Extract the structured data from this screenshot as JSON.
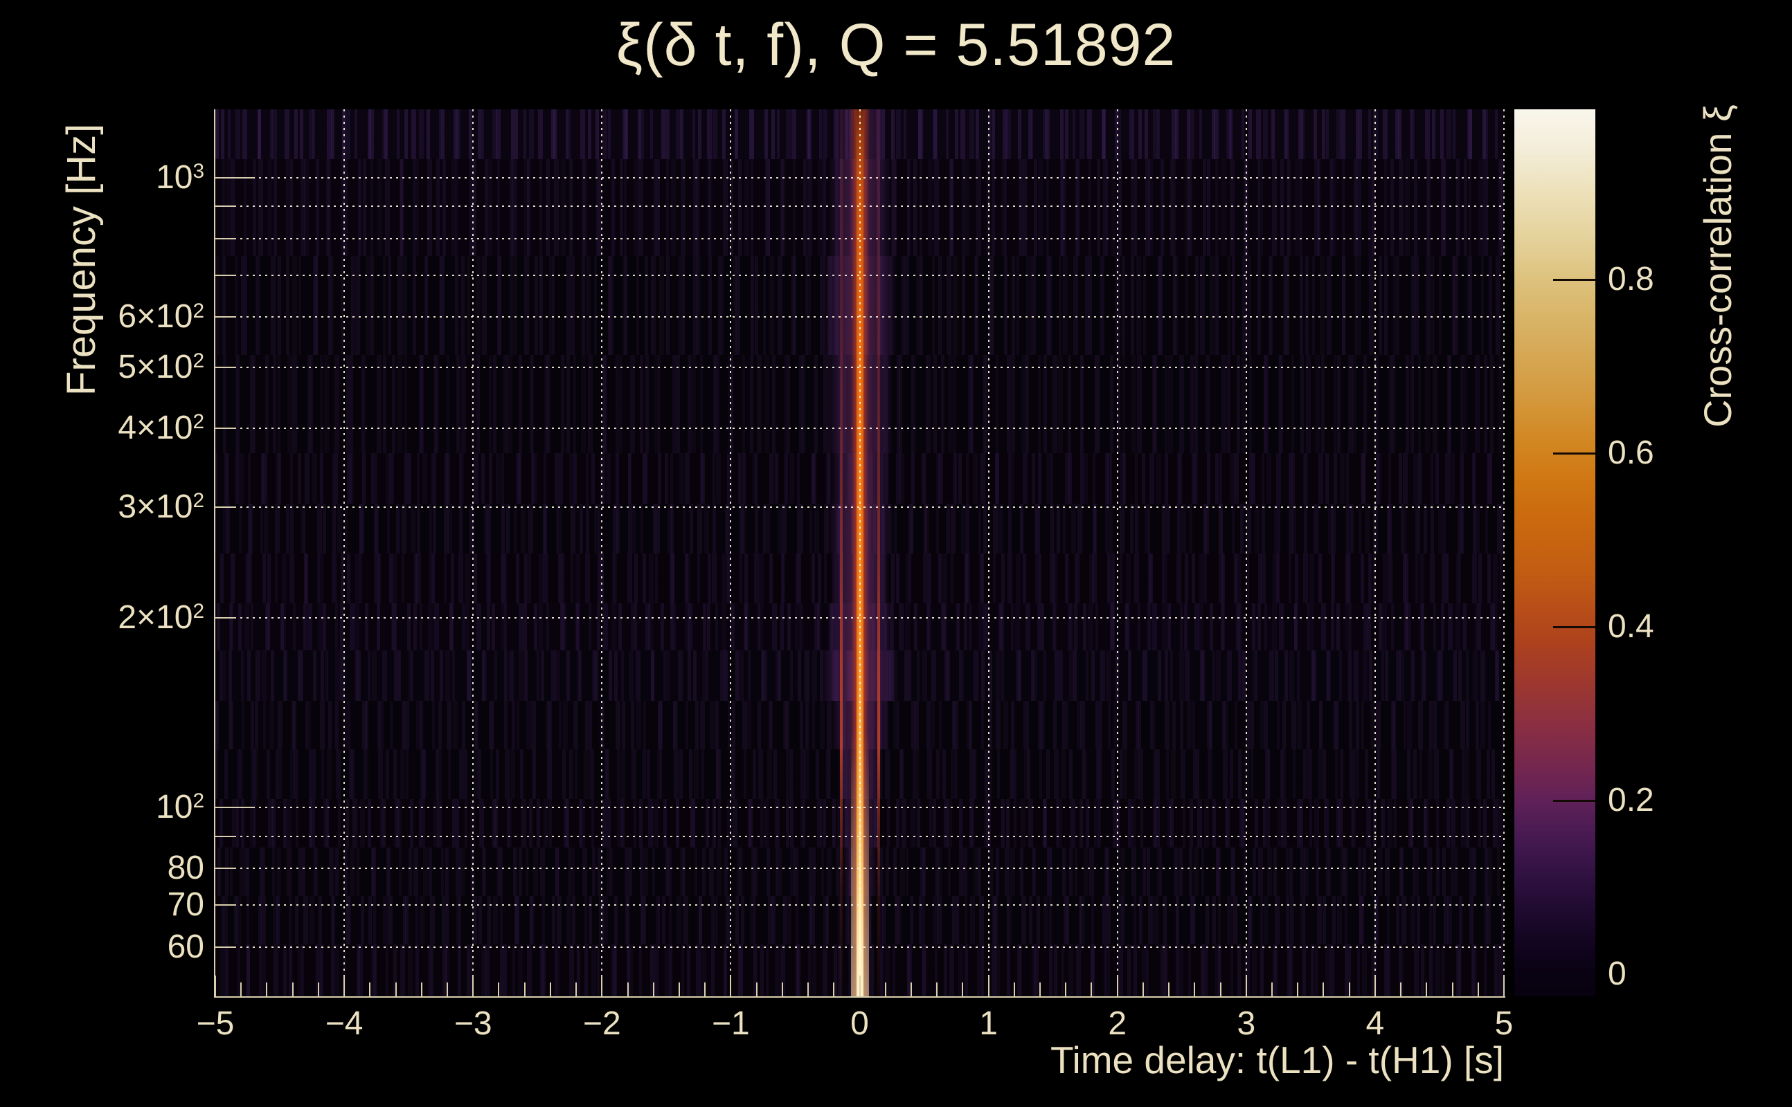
{
  "title": "ξ(δ t, f), Q = 5.51892",
  "axes": {
    "x": {
      "title": "Time delay: t(L1) - t(H1) [s]",
      "min": -5,
      "max": 5,
      "minor_step": 0.2,
      "ticks": [
        {
          "label": "−5",
          "value": -5
        },
        {
          "label": "−4",
          "value": -4
        },
        {
          "label": "−3",
          "value": -3
        },
        {
          "label": "−2",
          "value": -2
        },
        {
          "label": "−1",
          "value": -1
        },
        {
          "label": "0",
          "value": 0
        },
        {
          "label": "1",
          "value": 1
        },
        {
          "label": "2",
          "value": 2
        },
        {
          "label": "3",
          "value": 3
        },
        {
          "label": "4",
          "value": 4
        },
        {
          "label": "5",
          "value": 5
        }
      ],
      "gridline_values": [
        -4,
        -3,
        -2,
        -1,
        0,
        1,
        2,
        3,
        4,
        5
      ]
    },
    "y": {
      "title": "Frequency [Hz]",
      "scale": "log",
      "min_hz": 50,
      "max_hz": 1283,
      "ticks": [
        {
          "base": "10",
          "sup": "3",
          "value": 1000
        },
        {
          "base": "6×10",
          "sup": "2",
          "value": 600
        },
        {
          "base": "5×10",
          "sup": "2",
          "value": 500
        },
        {
          "base": "4×10",
          "sup": "2",
          "value": 400
        },
        {
          "base": "3×10",
          "sup": "2",
          "value": 300
        },
        {
          "base": "2×10",
          "sup": "2",
          "value": 200
        },
        {
          "base": "10",
          "sup": "2",
          "value": 100
        },
        {
          "base": "80",
          "value": 80
        },
        {
          "base": "70",
          "value": 70
        },
        {
          "base": "60",
          "value": 60
        }
      ],
      "gridline_values": [
        60,
        70,
        80,
        90,
        100,
        200,
        300,
        400,
        500,
        600,
        700,
        800,
        900,
        1000
      ]
    }
  },
  "colorbar": {
    "title": "Cross-correlation ξ",
    "min": -0.03,
    "max": 1.02,
    "ticks": [
      {
        "label": "0.8",
        "value": 0.8
      },
      {
        "label": "0.6",
        "value": 0.6
      },
      {
        "label": "0.4",
        "value": 0.4
      },
      {
        "label": "0.2",
        "value": 0.2
      },
      {
        "label": "0",
        "value": 0
      }
    ],
    "gradient_top_to_bottom": [
      "#f9f6ec",
      "#e2cd92",
      "#d7b061",
      "#d2851f",
      "#cb6a0f",
      "#b94f18",
      "#9c3730",
      "#702551",
      "#471a52",
      "#200b31",
      "#070110"
    ],
    "text_color": "#ece2c2",
    "grid_color": "#f6f0db"
  },
  "chart_data": {
    "type": "heatmap",
    "title": "ξ(δ t, f), Q = 5.51892",
    "q_value": 5.51892,
    "xlabel": "Time delay: t(L1) - t(H1) [s]",
    "ylabel": "Frequency [Hz]",
    "zlabel": "Cross-correlation ξ",
    "x_range_s": [
      -5,
      5
    ],
    "y_range_hz": [
      50,
      1283
    ],
    "y_scale": "log",
    "z_range": [
      -0.03,
      1.02
    ],
    "background_xi": 0.0,
    "grid": "dotted, on",
    "ridge": {
      "center_time_delay_s": 0.0,
      "description": "Single narrow vertical ridge of high cross-correlation at zero time delay spanning the full frequency band; core width ~0.05 s, brightest (xi→1) below ~150 Hz, surrounded by a purple halo of width ~±0.1–0.3 s that is widest near 150–300 Hz.",
      "bands": [
        {
          "f_lo_hz": 49,
          "f_hi_hz": 59,
          "halo_halfwidth_s": 0.09,
          "core_xi": 0.98
        },
        {
          "f_lo_hz": 59,
          "f_hi_hz": 71,
          "halo_halfwidth_s": 0.1,
          "core_xi": 0.96
        },
        {
          "f_lo_hz": 71,
          "f_hi_hz": 85,
          "halo_halfwidth_s": 0.13,
          "core_xi": 0.93
        },
        {
          "f_lo_hz": 85,
          "f_hi_hz": 102,
          "halo_halfwidth_s": 0.15,
          "core_xi": 0.9
        },
        {
          "f_lo_hz": 102,
          "f_hi_hz": 122,
          "halo_halfwidth_s": 0.18,
          "core_xi": 0.87
        },
        {
          "f_lo_hz": 122,
          "f_hi_hz": 146,
          "halo_halfwidth_s": 0.23,
          "core_xi": 0.83
        },
        {
          "f_lo_hz": 146,
          "f_hi_hz": 175,
          "halo_halfwidth_s": 0.3,
          "core_xi": 0.78
        },
        {
          "f_lo_hz": 175,
          "f_hi_hz": 209,
          "halo_halfwidth_s": 0.26,
          "core_xi": 0.74
        },
        {
          "f_lo_hz": 209,
          "f_hi_hz": 253,
          "halo_halfwidth_s": 0.23,
          "core_xi": 0.72
        },
        {
          "f_lo_hz": 253,
          "f_hi_hz": 304,
          "halo_halfwidth_s": 0.25,
          "core_xi": 0.7
        },
        {
          "f_lo_hz": 304,
          "f_hi_hz": 366,
          "halo_halfwidth_s": 0.23,
          "core_xi": 0.68
        },
        {
          "f_lo_hz": 366,
          "f_hi_hz": 524,
          "halo_halfwidth_s": 0.26,
          "core_xi": 0.66
        },
        {
          "f_lo_hz": 524,
          "f_hi_hz": 753,
          "halo_halfwidth_s": 0.29,
          "core_xi": 0.62
        },
        {
          "f_lo_hz": 753,
          "f_hi_hz": 1069,
          "halo_halfwidth_s": 0.25,
          "core_xi": 0.55
        },
        {
          "f_lo_hz": 1069,
          "f_hi_hz": 1283,
          "halo_halfwidth_s": 0.2,
          "core_xi": 0.45
        }
      ]
    }
  }
}
